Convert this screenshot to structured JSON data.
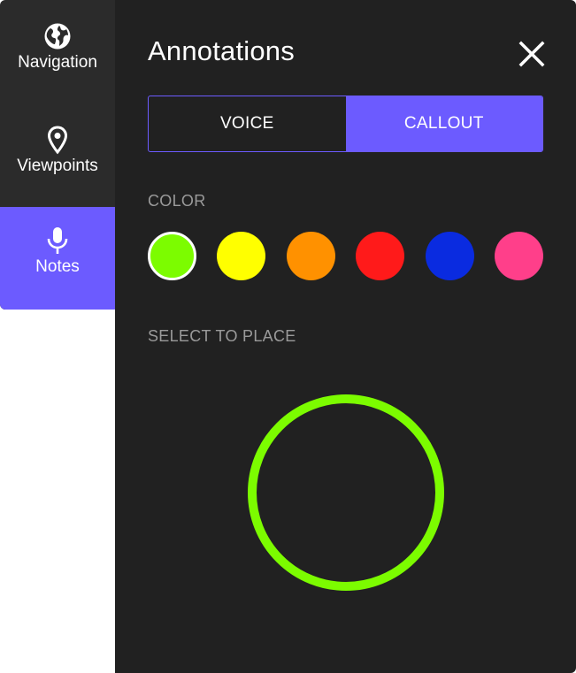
{
  "sidebar": {
    "items": [
      {
        "label": "Navigation",
        "icon": "globe-icon",
        "active": false
      },
      {
        "label": "Viewpoints",
        "icon": "location-pin-icon",
        "active": false
      },
      {
        "label": "Notes",
        "icon": "microphone-icon",
        "active": true
      }
    ]
  },
  "panel": {
    "title": "Annotations",
    "close_icon": "close-icon",
    "tabs": [
      {
        "label": "VOICE",
        "active": false
      },
      {
        "label": "CALLOUT",
        "active": true
      }
    ],
    "color_label": "COLOR",
    "colors": [
      "#7cfc00",
      "#ffff00",
      "#ff9100",
      "#ff1a1a",
      "#0a2be0",
      "#ff3f8a"
    ],
    "selected_color": "#7cfc00",
    "place_label": "SELECT TO PLACE"
  },
  "theme": {
    "accent": "#6c5bff",
    "panel_bg": "#212121",
    "sidebar_bg": "#2b2b2b"
  }
}
